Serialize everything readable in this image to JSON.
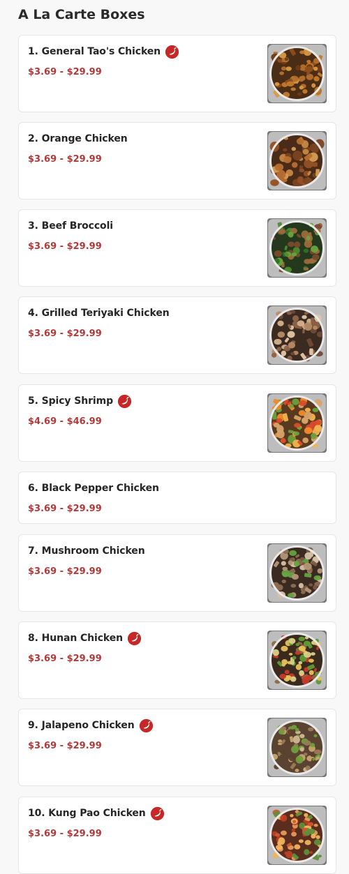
{
  "section": {
    "title": "A La Carte Boxes"
  },
  "colors": {
    "accent": "#b13b3b",
    "spicy_badge": "#c62828",
    "card_background": "#ffffff",
    "page_background": "#f8f8f8"
  },
  "items": [
    {
      "name": "1. General Tao's Chicken",
      "price": "$3.69 - $29.99",
      "spicy": true,
      "icon": "chili-pepper-icon",
      "has_photo": true,
      "photo": "general-tao-chicken-photo",
      "photo_style": "fried"
    },
    {
      "name": "2. Orange Chicken",
      "price": "$3.69 - $29.99",
      "spicy": false,
      "has_photo": true,
      "photo": "orange-chicken-photo",
      "photo_style": "orange"
    },
    {
      "name": "3. Beef Broccoli",
      "price": "$3.69 - $29.99",
      "spicy": false,
      "has_photo": true,
      "photo": "beef-broccoli-photo",
      "photo_style": "broccoli"
    },
    {
      "name": "4. Grilled Teriyaki Chicken",
      "price": "$3.69 - $29.99",
      "spicy": false,
      "has_photo": true,
      "photo": "teriyaki-chicken-photo",
      "photo_style": "teriyaki"
    },
    {
      "name": "5. Spicy Shrimp",
      "price": "$4.69 - $46.99",
      "spicy": true,
      "icon": "chili-pepper-icon",
      "has_photo": true,
      "photo": "spicy-shrimp-photo",
      "photo_style": "shrimp"
    },
    {
      "name": "6. Black Pepper Chicken",
      "price": "$3.69 - $29.99",
      "spicy": false,
      "has_photo": false
    },
    {
      "name": "7. Mushroom Chicken",
      "price": "$3.69 - $29.99",
      "spicy": false,
      "has_photo": true,
      "photo": "mushroom-chicken-photo",
      "photo_style": "mushroom"
    },
    {
      "name": "8. Hunan Chicken",
      "price": "$3.69 - $29.99",
      "spicy": true,
      "icon": "chili-pepper-icon",
      "has_photo": true,
      "photo": "hunan-chicken-photo",
      "photo_style": "mixed"
    },
    {
      "name": "9. Jalapeno Chicken",
      "price": "$3.69 - $29.99",
      "spicy": true,
      "icon": "chili-pepper-icon",
      "has_photo": true,
      "photo": "jalapeno-chicken-photo",
      "photo_style": "jalapeno"
    },
    {
      "name": "10. Kung Pao Chicken",
      "price": "$3.69 - $29.99",
      "spicy": true,
      "icon": "chili-pepper-icon",
      "has_photo": true,
      "photo": "kung-pao-chicken-photo",
      "photo_style": "kungpao"
    }
  ]
}
